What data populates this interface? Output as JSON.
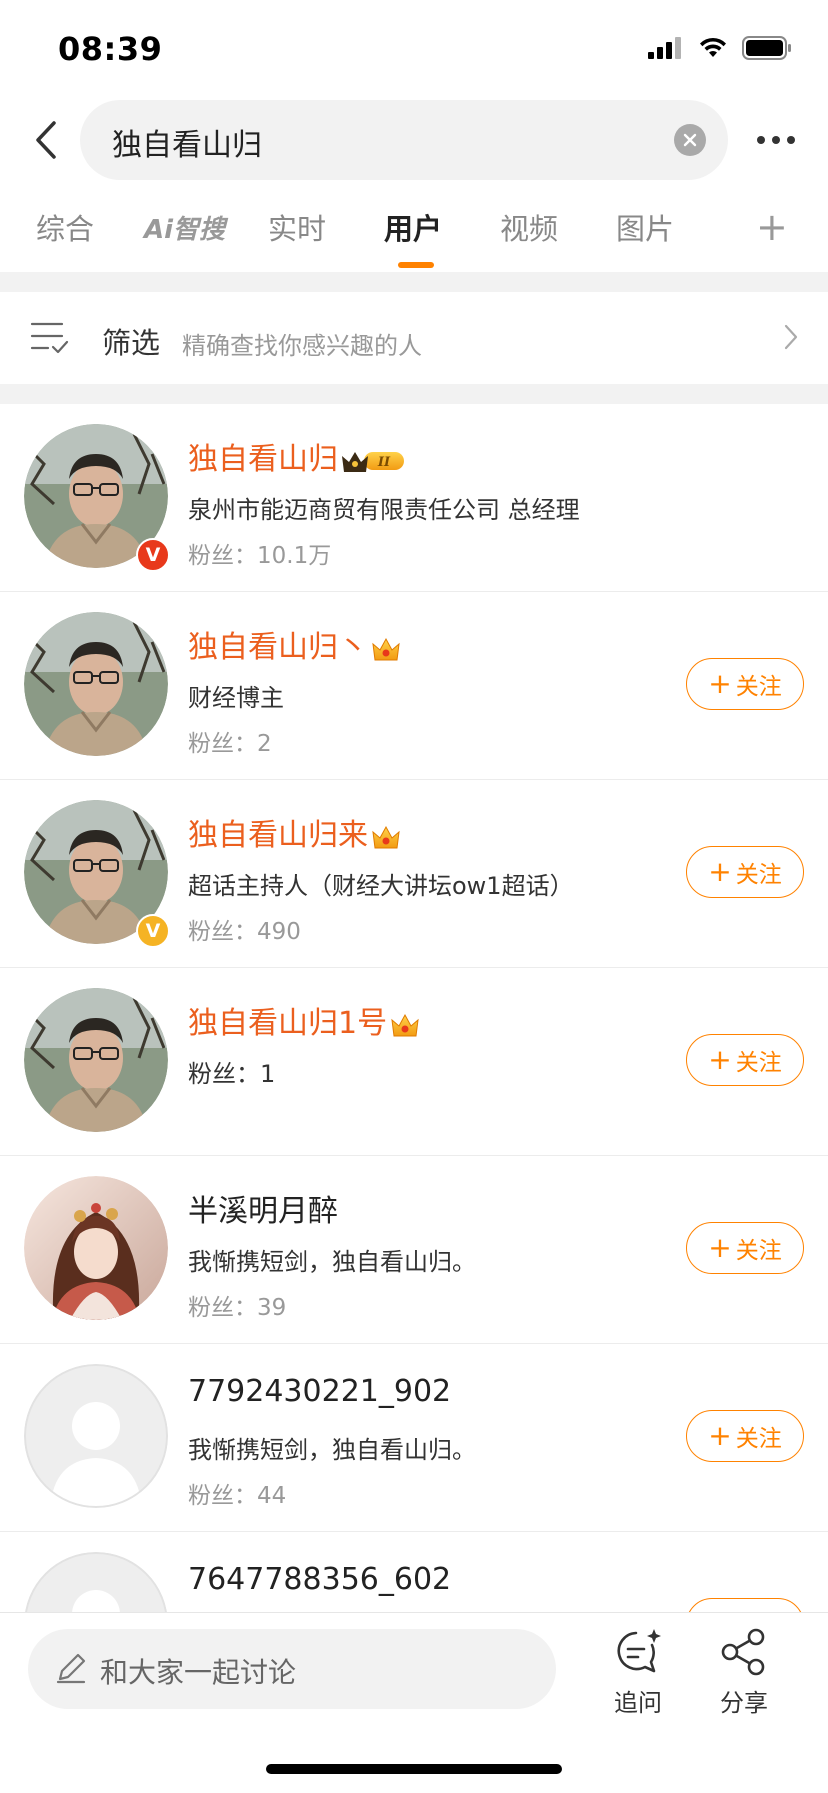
{
  "status_bar": {
    "time": "08:39"
  },
  "search": {
    "query": "独自看山归"
  },
  "tabs": [
    {
      "label": "综合"
    },
    {
      "label": "Ai智搜"
    },
    {
      "label": "实时"
    },
    {
      "label": "用户"
    },
    {
      "label": "视频"
    },
    {
      "label": "图片"
    }
  ],
  "active_tab": "用户",
  "filter": {
    "title": "筛选",
    "subtitle": "精确查找你感兴趣的人"
  },
  "follow_label": "关注",
  "users": [
    {
      "name": "独自看山归",
      "desc": "泉州市能迈商贸有限责任公司 总经理",
      "fans": "粉丝：10.1万",
      "verified": "red",
      "badge": "crown-level-badge",
      "follow": false
    },
    {
      "name": "独自看山归丶",
      "desc": "财经博主",
      "fans": "粉丝：2",
      "verified": "",
      "badge": "crown-badge",
      "follow": true
    },
    {
      "name": "独自看山归来",
      "desc": "超话主持人（财经大讲坛ow1超话）",
      "fans": "粉丝：490",
      "verified": "gold",
      "badge": "crown-badge",
      "follow": true
    },
    {
      "name": "独自看山归1号",
      "desc": "",
      "fans": "粉丝：1",
      "verified": "",
      "badge": "crown-badge",
      "follow": true
    },
    {
      "name": "半溪明月醉",
      "desc": "我惭携短剑，独自看山归。",
      "fans": "粉丝：39",
      "verified": "",
      "badge": "",
      "follow": true
    },
    {
      "name": "7792430221_902",
      "desc": "我惭携短剑，独自看山归。",
      "fans": "粉丝：44",
      "verified": "",
      "badge": "",
      "follow": true
    },
    {
      "name": "7647788356_602",
      "desc": "",
      "fans": "",
      "verified": "",
      "badge": "",
      "follow": true
    }
  ],
  "bottom_bar": {
    "placeholder": "和大家一起讨论",
    "ask_label": "追问",
    "share_label": "分享"
  },
  "colors": {
    "accent": "#ff8200",
    "name_highlight": "#eb5f1e",
    "verify_red": "#e8391b",
    "verify_gold": "#f5b324"
  }
}
